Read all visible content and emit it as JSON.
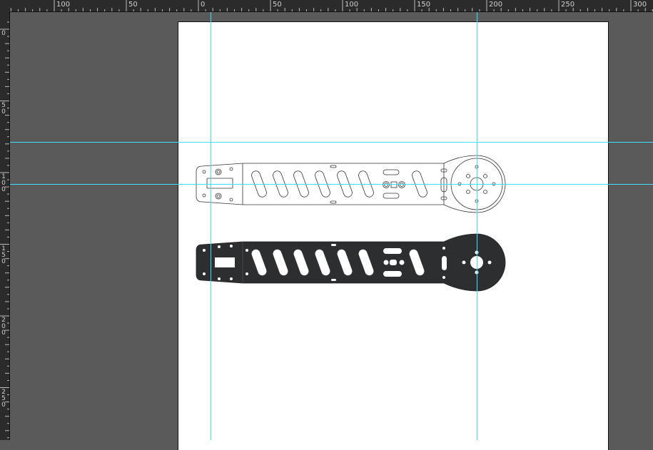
{
  "ruler_top_labels": [
    "100",
    "50",
    "0",
    "50",
    "100",
    "150",
    "200",
    "250",
    "300"
  ],
  "ruler_left_labels": [
    "0",
    "50",
    "100",
    "150",
    "200",
    "250"
  ],
  "colors": {
    "workspace": "#5a5a5a",
    "ruler": "#2b2b2b",
    "artboard": "#ffffff",
    "guide": "#3fe0ff",
    "part_fill": "#2c2e2f",
    "outline": "#333333"
  },
  "objects": {
    "outline_part": "drone-arm-outline",
    "filled_part": "drone-arm-filled"
  }
}
